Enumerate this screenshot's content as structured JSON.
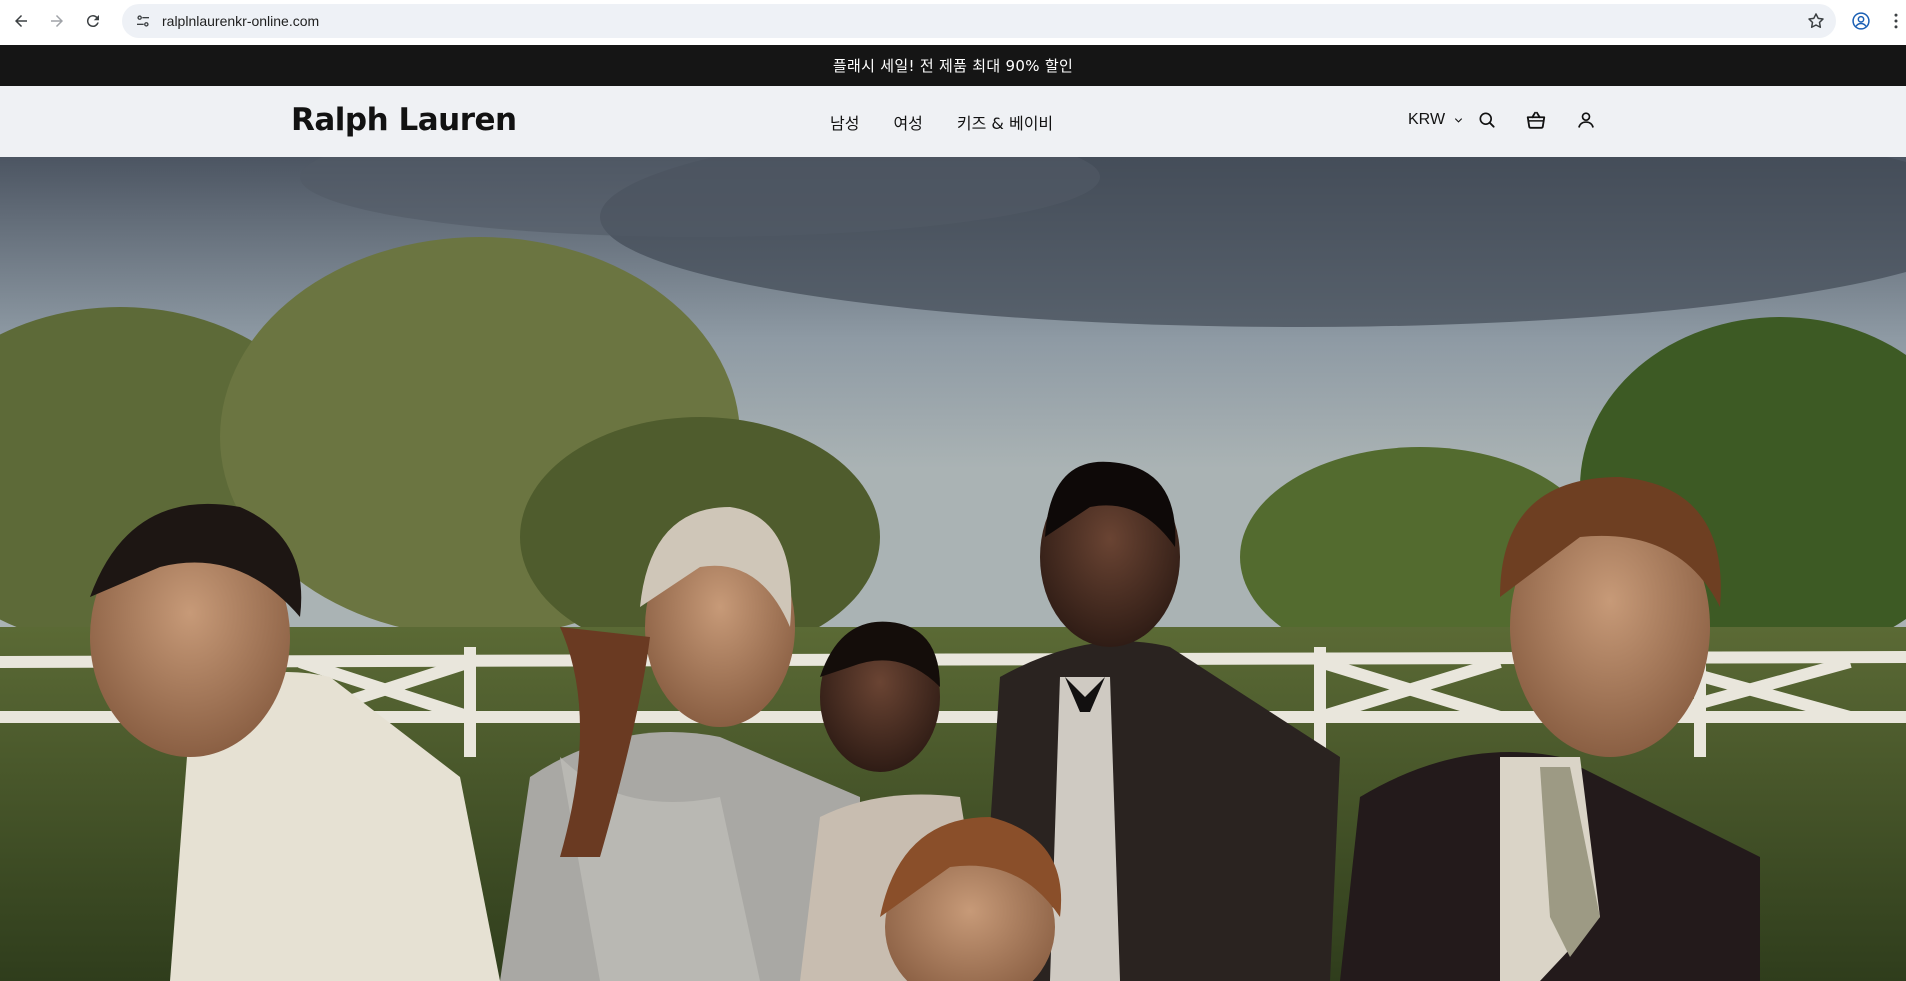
{
  "browser": {
    "url": "ralplnlaurenkr-online.com"
  },
  "announcement": {
    "text": "플래시 세일! 전 제품 최대 90% 할인"
  },
  "header": {
    "logo": "Ralph Lauren",
    "nav": [
      {
        "label": "남성"
      },
      {
        "label": "여성"
      },
      {
        "label": "키즈 & 베이비"
      }
    ],
    "currency": "KRW",
    "icons": [
      "search-icon",
      "cart-icon",
      "account-icon"
    ]
  },
  "colors": {
    "announcement_bg": "#151515",
    "header_bg": "#eff1f4",
    "text": "#121212"
  }
}
